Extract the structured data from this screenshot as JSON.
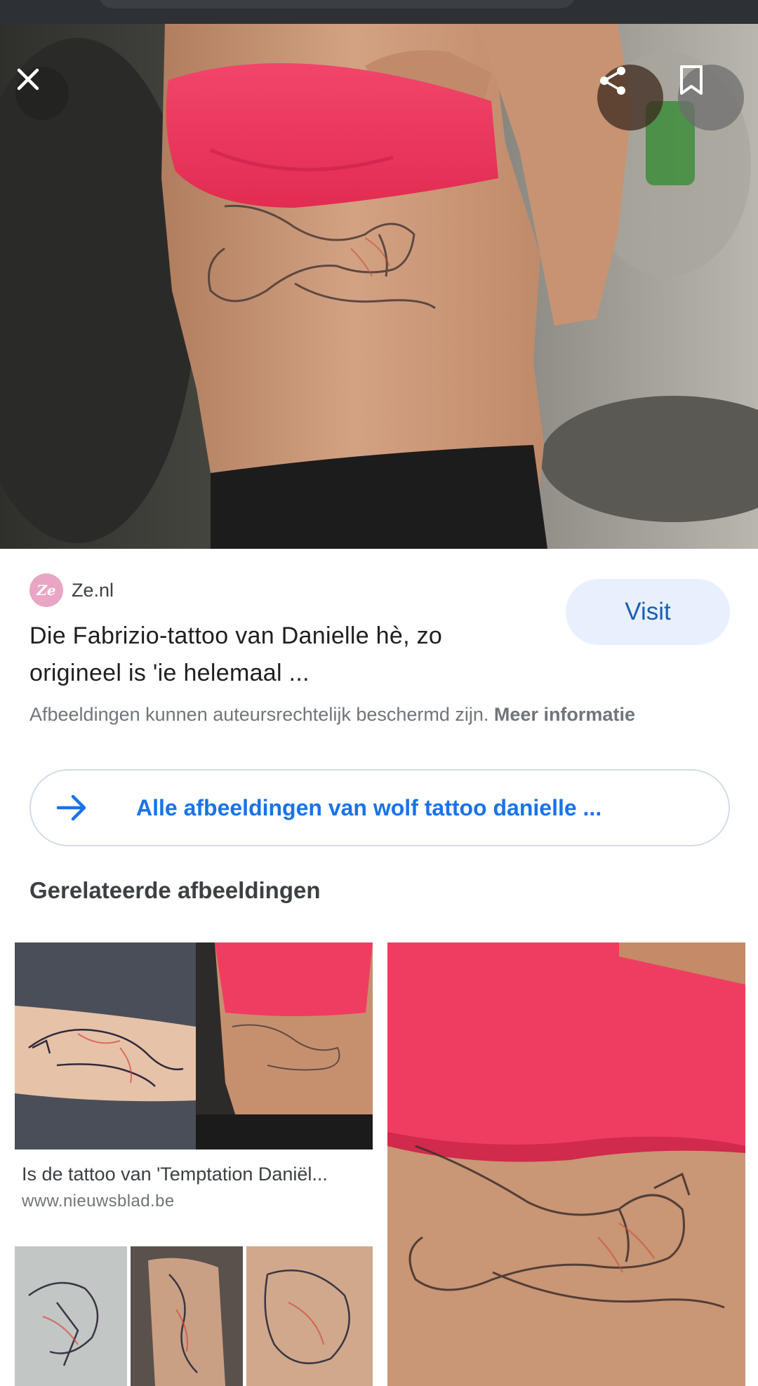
{
  "source": {
    "favicon_text": "Ze",
    "name": "Ze.nl",
    "title": "Die Fabrizio-tattoo van Danielle hè, zo origineel is 'ie helemaal ...",
    "visit_label": "Visit"
  },
  "notice": {
    "text": "Afbeeldingen kunnen auteursrechtelijk beschermd zijn. ",
    "link": "Meer informatie"
  },
  "all_images": {
    "label": "Alle afbeeldingen van wolf tattoo danielle ..."
  },
  "related": {
    "heading": "Gerelateerde afbeeldingen",
    "items": [
      {
        "caption": "Is de tattoo van 'Temptation Daniël...",
        "site": "www.nieuwsblad.be"
      }
    ]
  },
  "icons": {
    "close": "close-icon",
    "share": "share-icon",
    "save": "bookmark-icon",
    "arrow": "arrow-right-icon"
  },
  "colors": {
    "accent": "#1a73e8",
    "visit_bg": "#e8f0fe",
    "top_red": "#f03a5c"
  }
}
